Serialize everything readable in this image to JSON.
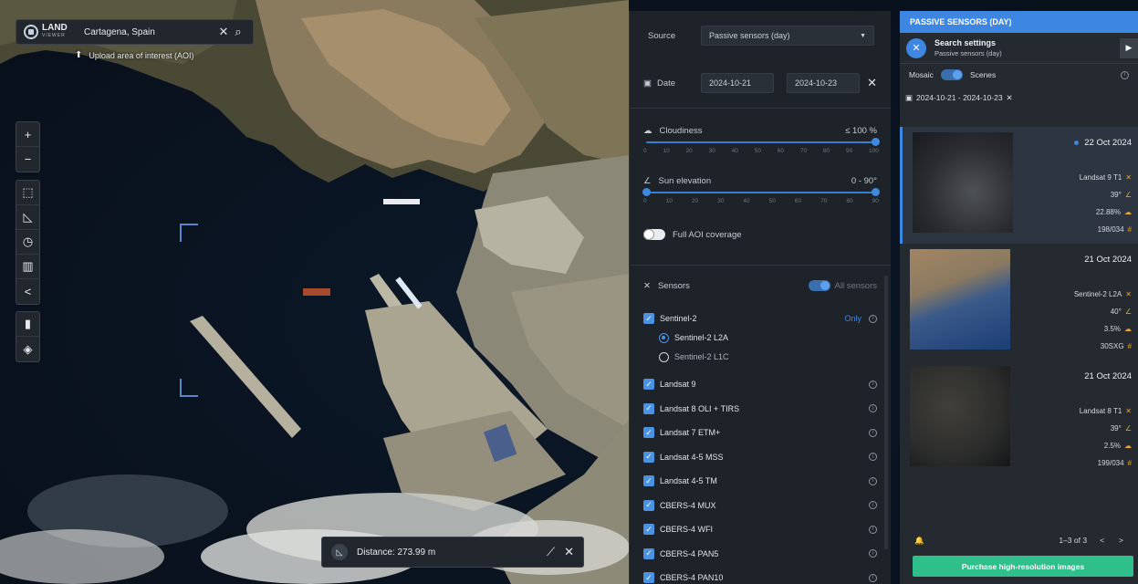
{
  "map": {
    "logo_text": "LAND",
    "logo_sub": "VIEWER",
    "search_value": "Cartagena, Spain",
    "upload_label": "Upload area of interest (AOI)",
    "distance_label": "Distance: 273.99 m"
  },
  "settings": {
    "source_label": "Source",
    "source_value": "Passive sensors (day)",
    "date_label": "Date",
    "date_from": "2024-10-21",
    "date_to": "2024-10-23",
    "cloudiness_label": "Cloudiness",
    "cloudiness_value": "≤ 100 %",
    "cloudiness_ticks": [
      "0",
      "10",
      "20",
      "30",
      "40",
      "50",
      "60",
      "70",
      "80",
      "90",
      "100"
    ],
    "sun_label": "Sun elevation",
    "sun_value": "0 - 90°",
    "sun_ticks": [
      "0",
      "10",
      "20",
      "30",
      "40",
      "50",
      "60",
      "70",
      "80",
      "90"
    ],
    "full_aoi_label": "Full AOI coverage",
    "sensors_label": "Sensors",
    "all_sensors_label": "All sensors",
    "only_label": "Only",
    "sentinel": "Sentinel-2",
    "sentinel_l2a": "Sentinel-2 L2A",
    "sentinel_l1c": "Sentinel-2 L1C",
    "sensors": [
      "Landsat 9",
      "Landsat 8 OLI + TIRS",
      "Landsat 7 ETM+",
      "Landsat 4-5 MSS",
      "Landsat 4-5 TM",
      "CBERS-4 MUX",
      "CBERS-4 WFI",
      "CBERS-4 PAN5",
      "CBERS-4 PAN10"
    ]
  },
  "results": {
    "header": "PASSIVE SENSORS (DAY)",
    "search_title": "Search settings",
    "search_sub": "Passive sensors (day)",
    "mosaic": "Mosaic",
    "scenes": "Scenes",
    "date_range": "2024-10-21 - 2024-10-23",
    "items": [
      {
        "date": "22 Oct 2024",
        "sensor": "Landsat 9  T1",
        "sun": "39°",
        "cloud": "22.88%",
        "tile": "198/034"
      },
      {
        "date": "21 Oct 2024",
        "sensor": "Sentinel-2  L2A",
        "sun": "40°",
        "cloud": "3.5%",
        "tile": "30SXG"
      },
      {
        "date": "21 Oct 2024",
        "sensor": "Landsat 8  T1",
        "sun": "39°",
        "cloud": "2.5%",
        "tile": "199/034"
      }
    ],
    "pager": "1–3 of 3",
    "purchase": "Purchase high-resolution images"
  }
}
